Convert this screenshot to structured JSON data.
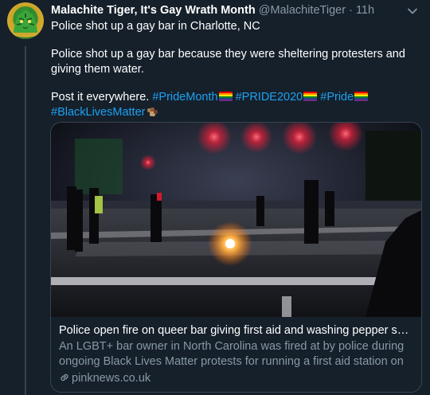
{
  "tweet": {
    "display_name": "Malachite Tiger, It's Gay Wrath Month",
    "handle": "@MalachiteTiger",
    "separator": "·",
    "time": "11h",
    "line1": "Police shot up a gay bar in Charlotte, NC",
    "line2": "Police shot up a gay bar because they were sheltering protesters and giving them water.",
    "line3_prefix": "Post it everywhere. ",
    "hashtags": [
      "#PrideMonth",
      "#PRIDE2020",
      "#Pride",
      "#BlackLivesMatter"
    ]
  },
  "card": {
    "title": "Police open fire on queer bar giving first aid and washing pepper spra...",
    "description": "An LGBT+ bar owner in North Carolina was fired at by police during ongoing Black Lives Matter protests for running a first aid station on ...",
    "domain": "pinknews.co.uk"
  },
  "icons": {
    "avatar": "tiger-avatar-icon",
    "caret": "chevron-down-icon",
    "flag": "rainbow-flag-icon",
    "fist": "raised-fist-icon",
    "link": "link-icon"
  },
  "colors": {
    "background": "#15202b",
    "text": "#ffffff",
    "muted": "#8899a6",
    "hashtag": "#1da1f2",
    "border": "#38444d"
  }
}
